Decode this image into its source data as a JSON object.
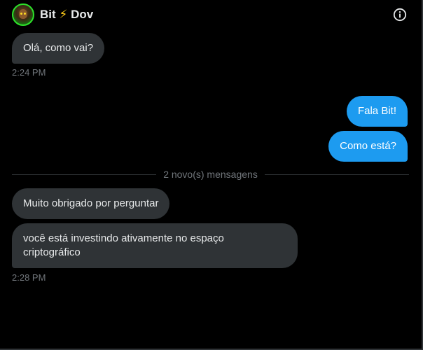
{
  "header": {
    "title_left": "Bit",
    "title_emoji": "⚡",
    "title_right": "Dov",
    "avatar_icon": "bull-avatar-icon",
    "info_icon": "info-circle-icon"
  },
  "conversation": {
    "messages_before": [
      {
        "text": "Olá, como vai?",
        "direction": "received"
      }
    ],
    "time_1": "2:24 PM",
    "sent": [
      {
        "text": "Fala Bit!",
        "direction": "sent"
      },
      {
        "text": "Como está?",
        "direction": "sent"
      }
    ],
    "divider_label": "2 novo(s) mensagens",
    "messages_after": [
      {
        "text": "Muito obrigado por perguntar",
        "direction": "received"
      },
      {
        "line1": "você está investindo ativamente no espaço",
        "line2": "criptográfico",
        "direction": "received"
      }
    ],
    "time_2": "2:28 PM"
  },
  "colors": {
    "background": "#000000",
    "received_bubble": "#2f3336",
    "sent_bubble": "#1d9bf0",
    "muted_text": "#71767b",
    "avatar_ring": "#2de22a"
  }
}
